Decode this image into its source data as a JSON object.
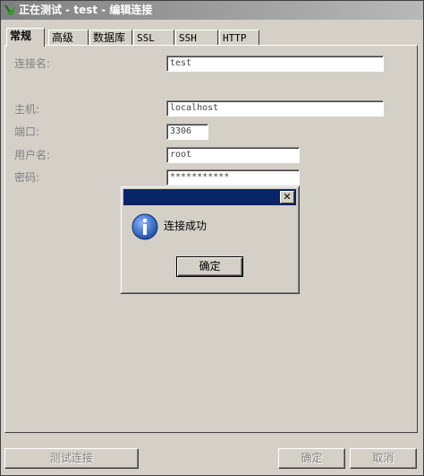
{
  "window": {
    "title": "正在测试 - test - 编辑连接"
  },
  "tabs": [
    {
      "label": "常规",
      "active": true
    },
    {
      "label": "高级"
    },
    {
      "label": "数据库"
    },
    {
      "label": "SSL"
    },
    {
      "label": "SSH"
    },
    {
      "label": "HTTP"
    }
  ],
  "form": {
    "connection_name": {
      "label": "连接名:",
      "value": "test"
    },
    "host": {
      "label": "主机:",
      "value": "localhost"
    },
    "port": {
      "label": "端口:",
      "value": "3306"
    },
    "username": {
      "label": "用户名:",
      "value": "root"
    },
    "password": {
      "label": "密码:",
      "value": "***********"
    }
  },
  "dialog": {
    "message": "连接成功",
    "ok_label": "确定",
    "close_glyph": "✕"
  },
  "footer": {
    "test_label": "测试连接",
    "ok_label": "确定",
    "cancel_label": "取消"
  },
  "colors": {
    "dialog_title": "#0a246a",
    "info_blue": "#1f4fa8",
    "face": "#d4d0c8"
  },
  "icons": [
    "app-icon",
    "info-icon",
    "close-icon"
  ]
}
